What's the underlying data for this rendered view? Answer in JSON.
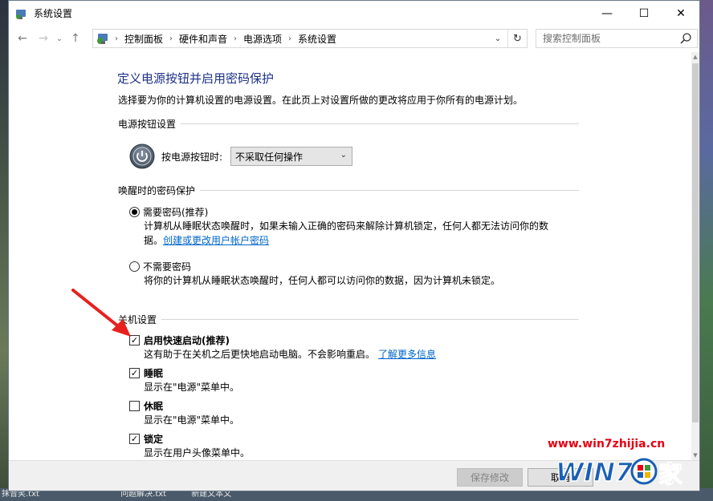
{
  "window": {
    "title": "系统设置",
    "controls": {
      "minimize": "—",
      "maximize": "☐",
      "close": "✕"
    }
  },
  "nav": {
    "back": "←",
    "forward": "→",
    "dropdown": "⌄",
    "up": "↑"
  },
  "address": {
    "crumbs": [
      "控制面板",
      "硬件和声音",
      "电源选项",
      "系统设置"
    ],
    "separator": "›",
    "dropdown": "⌄",
    "refresh": "↻"
  },
  "search": {
    "placeholder": "搜索控制面板"
  },
  "page": {
    "title": "定义电源按钮并启用密码保护",
    "description": "选择要为你的计算机设置的电源设置。在此页上对设置所做的更改将应用于你所有的电源计划。"
  },
  "power_section": {
    "heading": "电源按钮设置",
    "label": "按电源按钮时:",
    "selected": "不采取任何操作"
  },
  "wake_section": {
    "heading": "唤醒时的密码保护",
    "option1": {
      "label": "需要密码(推荐)",
      "checked": true,
      "desc_line1": "计算机从睡眠状态唤醒时，如果未输入正确的密码来解除计算机锁定，任何人都无法访问你的数",
      "desc_line2_prefix": "据。",
      "desc_link": "创建或更改用户帐户密码"
    },
    "option2": {
      "label": "不需要密码",
      "checked": false,
      "desc": "将你的计算机从睡眠状态唤醒时，任何人都可以访问你的数据，因为计算机未锁定。"
    }
  },
  "shutdown_section": {
    "heading": "关机设置",
    "items": [
      {
        "label": "启用快速启动(推荐)",
        "checked": true,
        "desc": "这有助于在关机之后更快地启动电脑。不会影响重启。",
        "link": "了解更多信息"
      },
      {
        "label": "睡眠",
        "checked": true,
        "desc": "显示在\"电源\"菜单中。"
      },
      {
        "label": "休眠",
        "checked": false,
        "desc": "显示在\"电源\"菜单中。"
      },
      {
        "label": "锁定",
        "checked": true,
        "desc": "显示在用户头像菜单中。"
      }
    ],
    "checkmark": "✓"
  },
  "footer": {
    "save": "保存修改",
    "cancel": "取消"
  },
  "scrollbar": {
    "up": "▲",
    "down": "▼"
  },
  "watermark": {
    "url": "www.win7zhijia.cn",
    "logo": "WIN7",
    "logo_suffix": "家"
  },
  "desktop": {
    "taskbar_items": [
      "抹音笑.txt",
      "问题解决.txt",
      "新建文本文"
    ]
  },
  "colors": {
    "title_blue": "#1e3287",
    "link_blue": "#0066cc",
    "arrow_red": "#e8201e",
    "watermark_red": "#e60012",
    "watermark_blue": "#1a5fb4"
  }
}
